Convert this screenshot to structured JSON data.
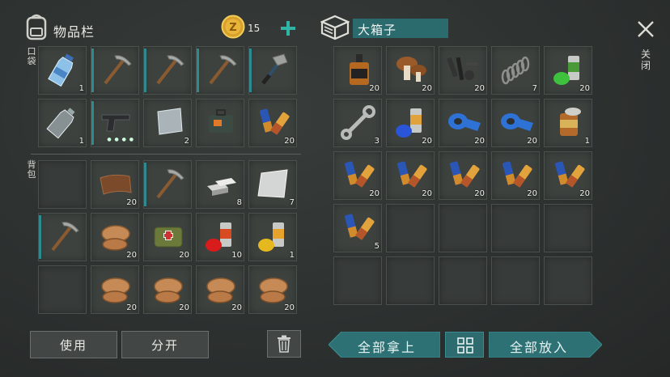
{
  "left": {
    "title": "物品栏",
    "coins": "15",
    "pocket_label": "口袋",
    "backpack_label": "背包",
    "pocket": [
      {
        "icon": "water-bottle",
        "count": "1"
      },
      {
        "icon": "pickaxe",
        "count": "",
        "durability": true
      },
      {
        "icon": "pickaxe",
        "count": "",
        "durability": true
      },
      {
        "icon": "pickaxe",
        "count": "",
        "durability": true
      },
      {
        "icon": "hammer",
        "count": "",
        "durability": true
      },
      {
        "icon": "empty-bottle",
        "count": "1"
      },
      {
        "icon": "pistol",
        "count": "",
        "durability": true
      },
      {
        "icon": "metal-plate",
        "count": "2"
      },
      {
        "icon": "medkit-bag",
        "count": ""
      },
      {
        "icon": "batteries",
        "count": "20"
      }
    ],
    "backpack": [
      {
        "icon": "empty",
        "count": ""
      },
      {
        "icon": "leather",
        "count": "20"
      },
      {
        "icon": "pickaxe",
        "count": "",
        "durability": true
      },
      {
        "icon": "iron-ingots",
        "count": "8"
      },
      {
        "icon": "steel-sheet",
        "count": "7"
      },
      {
        "icon": "pickaxe",
        "count": "",
        "durability": true
      },
      {
        "icon": "raw-meat",
        "count": "20"
      },
      {
        "icon": "first-aid-bag",
        "count": "20"
      },
      {
        "icon": "spray-can-red",
        "count": "10"
      },
      {
        "icon": "spray-can-yellow",
        "count": "1"
      },
      {
        "icon": "empty",
        "count": ""
      },
      {
        "icon": "raw-meat",
        "count": "20"
      },
      {
        "icon": "raw-meat",
        "count": "20"
      },
      {
        "icon": "raw-meat",
        "count": "20"
      },
      {
        "icon": "raw-meat",
        "count": "20"
      }
    ],
    "use_button": "使用",
    "split_button": "分开"
  },
  "right": {
    "title": "大箱子",
    "close_label": "关闭",
    "items": [
      {
        "icon": "whiskey-bottle",
        "count": "20"
      },
      {
        "icon": "mushrooms",
        "count": "20"
      },
      {
        "icon": "gun-parts",
        "count": "20"
      },
      {
        "icon": "spring",
        "count": "7"
      },
      {
        "icon": "spray-can-green",
        "count": "20"
      },
      {
        "icon": "wrench",
        "count": "3"
      },
      {
        "icon": "spray-can-blue",
        "count": "20"
      },
      {
        "icon": "duct-tape",
        "count": "20"
      },
      {
        "icon": "duct-tape",
        "count": "20"
      },
      {
        "icon": "food-can",
        "count": "1"
      },
      {
        "icon": "batteries",
        "count": "20"
      },
      {
        "icon": "batteries",
        "count": "20"
      },
      {
        "icon": "batteries",
        "count": "20"
      },
      {
        "icon": "batteries",
        "count": "20"
      },
      {
        "icon": "batteries",
        "count": "20"
      },
      {
        "icon": "batteries",
        "count": "5"
      }
    ],
    "take_all_button": "全部拿上",
    "put_all_button": "全部放入"
  }
}
